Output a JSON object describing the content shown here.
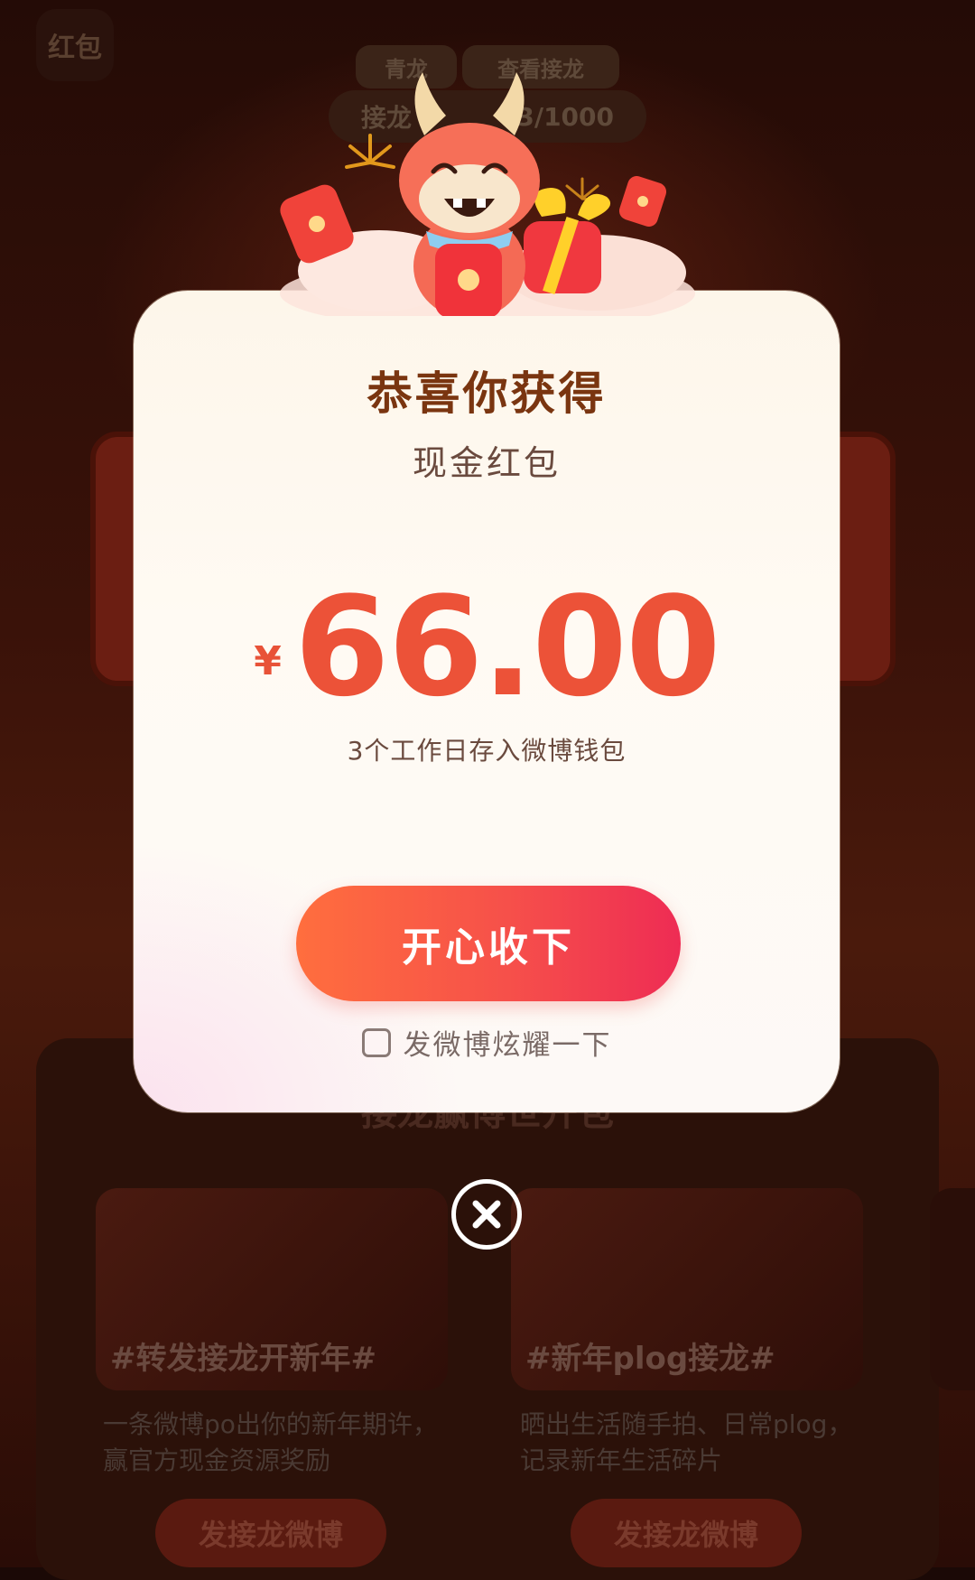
{
  "background": {
    "title": "红包",
    "tags": [
      "青龙",
      "查看接龙"
    ],
    "stat_label": "接龙",
    "stat_value": "3/1000",
    "panel_title": "接龙赢博世开包",
    "cards": [
      {
        "tag": "#转发接龙开新年#",
        "desc": "一条微博po出你的新年期许，赢官方现金资源奖励",
        "button": "发接龙微博"
      },
      {
        "tag": "#新年plog接龙#",
        "desc": "晒出生活随手拍、日常plog，记录新年生活碎片",
        "button": "发接龙微博"
      }
    ]
  },
  "modal": {
    "title": "恭喜你获得",
    "subtitle": "现金红包",
    "currency": "¥",
    "amount": "66.00",
    "deposit_note": "3个工作日存入微博钱包",
    "accept_label": "开心收下",
    "share_label": "发微博炫耀一下",
    "share_checked": false
  },
  "colors": {
    "accent": "#ec5238",
    "title": "#7a3510",
    "button_start": "#ff6e3e",
    "button_end": "#ee2c54"
  },
  "icons": {
    "close": "close-circle-icon",
    "mascot": "dragon-mascot",
    "checkbox": "checkbox-icon"
  }
}
